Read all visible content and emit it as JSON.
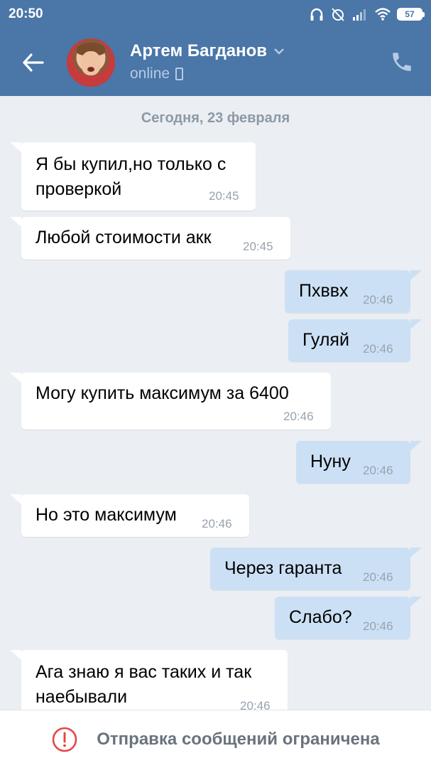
{
  "status_bar": {
    "time": "20:50",
    "battery": "57"
  },
  "header": {
    "contact_name": "Артем Багданов",
    "contact_status": "online"
  },
  "chat": {
    "date_divider": "Сегодня, 23 февраля",
    "messages": [
      {
        "direction": "in",
        "line1": "Я бы купил,но только с",
        "line2": "проверкой",
        "time": "20:45"
      },
      {
        "direction": "in",
        "line1": "Любой стоимости акк",
        "time": "20:45"
      },
      {
        "direction": "out",
        "line1": "Пхввх",
        "time": "20:46"
      },
      {
        "direction": "out",
        "line1": "Гуляй",
        "time": "20:46"
      },
      {
        "direction": "in",
        "line1": "Могу купить максимум за 6400",
        "time": "20:46"
      },
      {
        "direction": "out",
        "line1": "Нуну",
        "time": "20:46"
      },
      {
        "direction": "in",
        "line1": "Но это максимум",
        "time": "20:46"
      },
      {
        "direction": "out",
        "line1": "Через гаранта",
        "time": "20:46"
      },
      {
        "direction": "out",
        "line1": "Слабо?",
        "time": "20:46"
      },
      {
        "direction": "in",
        "line1": "Ага знаю я вас таких и так",
        "line2": "наебывали",
        "time": "20:46"
      }
    ]
  },
  "bottom_bar": {
    "notice": "Отправка сообщений ограничена",
    "icon": "alert-circle-icon"
  },
  "colors": {
    "header": "#4a76a8",
    "chat_bg": "#ebeef2",
    "incoming": "#ffffff",
    "outgoing": "#cce0f5",
    "alert": "#e64646"
  }
}
